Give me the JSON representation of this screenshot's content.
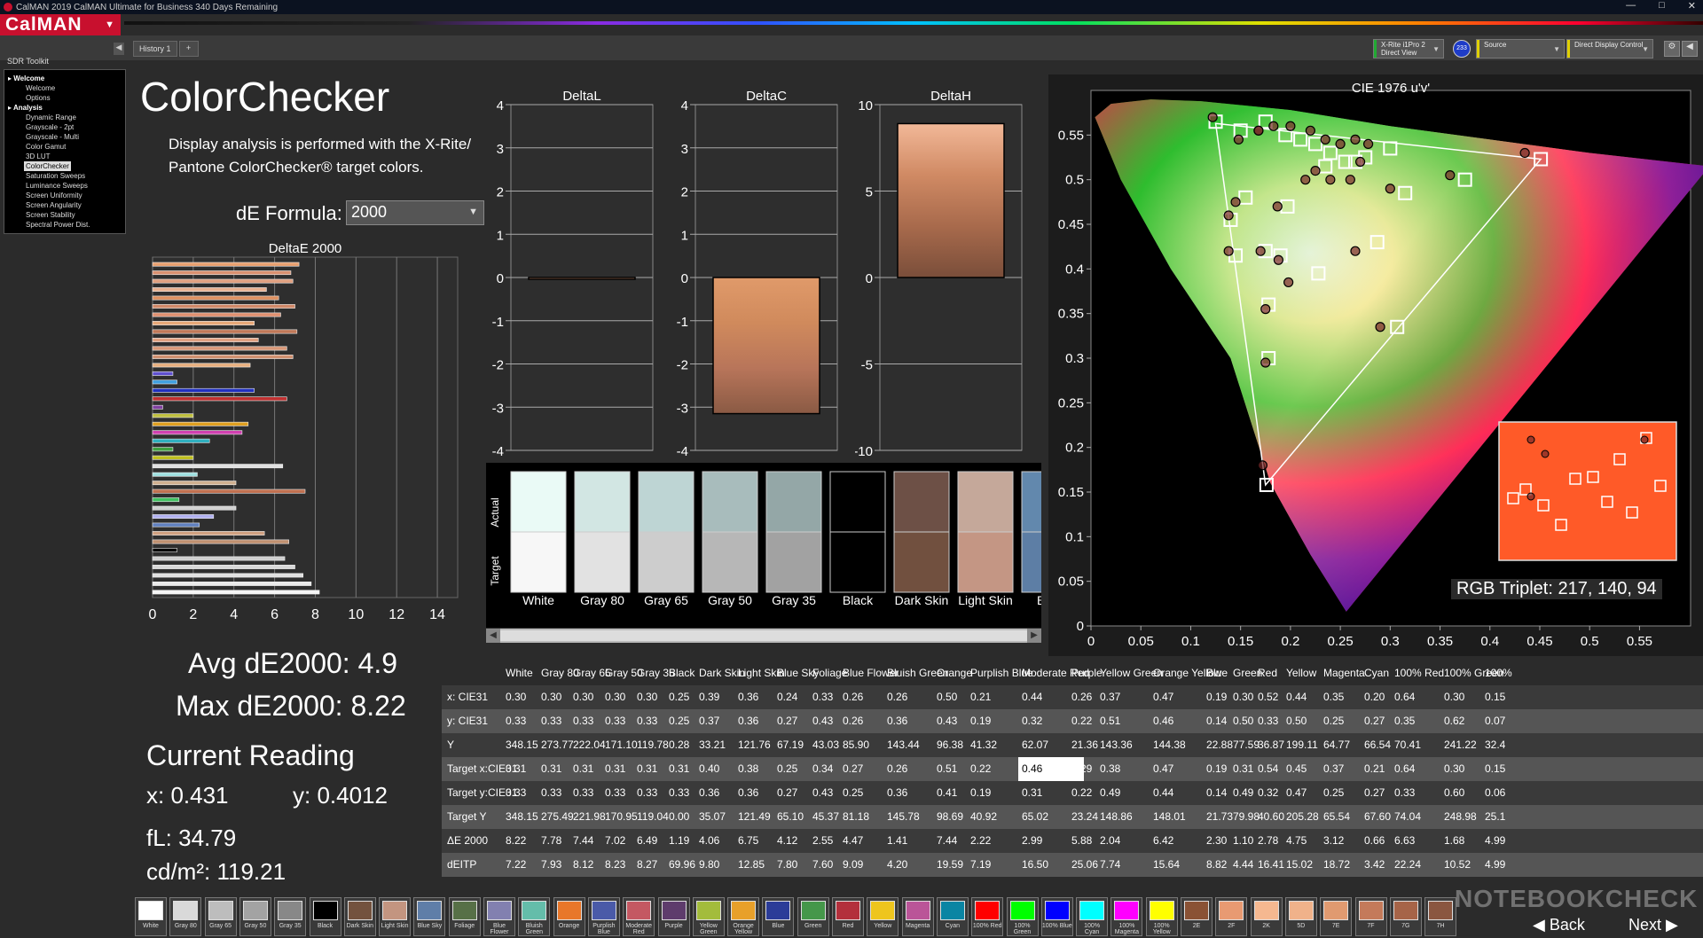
{
  "app": {
    "window_title": "CalMAN 2019 CalMAN Ultimate for Business 340 Days Remaining",
    "logo": "CalMAN",
    "window_buttons": [
      "—",
      "□",
      "✕"
    ]
  },
  "tabs": [
    {
      "label": "History 1"
    },
    {
      "label": "+"
    }
  ],
  "devices": {
    "meter": {
      "line1": "X-Rite i1Pro 2",
      "line2": "Direct View",
      "color": "#22aa33"
    },
    "badge": "233",
    "source": {
      "label": "Source",
      "color": "#e0d000"
    },
    "display": {
      "label": "Direct Display Control",
      "color": "#e0d000"
    }
  },
  "sidebar": {
    "title": "SDR Toolkit",
    "items": [
      {
        "label": "Welcome",
        "type": "group"
      },
      {
        "label": "Welcome",
        "type": "item"
      },
      {
        "label": "Options",
        "type": "item"
      },
      {
        "label": "Analysis",
        "type": "group"
      },
      {
        "label": "Dynamic Range",
        "type": "item"
      },
      {
        "label": "Grayscale - 2pt",
        "type": "item"
      },
      {
        "label": "Grayscale - Multi",
        "type": "item"
      },
      {
        "label": "Color Gamut",
        "type": "item"
      },
      {
        "label": "3D LUT",
        "type": "item"
      },
      {
        "label": "ColorChecker",
        "type": "item",
        "selected": true
      },
      {
        "label": "Saturation Sweeps",
        "type": "item"
      },
      {
        "label": "Luminance Sweeps",
        "type": "item"
      },
      {
        "label": "Screen Uniformity",
        "type": "item"
      },
      {
        "label": "Screen Angularity",
        "type": "item"
      },
      {
        "label": "Screen Stability",
        "type": "item"
      },
      {
        "label": "Spectral Power Dist.",
        "type": "item"
      }
    ]
  },
  "page": {
    "title": "ColorChecker",
    "description": "Display analysis is performed with the X-Rite/ Pantone ColorChecker® target colors.",
    "formula_label": "dE Formula:",
    "formula_value": "2000"
  },
  "stats": {
    "avg": "Avg dE2000: 4.9",
    "max": "Max dE2000: 8.22",
    "current_reading": "Current Reading",
    "x": "x: 0.431",
    "y": "y: 0.4012",
    "fl": "fL: 34.79",
    "cdm2": "cd/m²: 119.21"
  },
  "chart_data": [
    {
      "type": "bar",
      "title": "DeltaE 2000",
      "orientation": "horizontal",
      "xlim": [
        0,
        15
      ],
      "xticks": [
        "0",
        "2",
        "4",
        "6",
        "8",
        "10",
        "12",
        "14"
      ],
      "bars": [
        {
          "value": 7.2,
          "color": "#e8a070"
        },
        {
          "value": 6.8,
          "color": "#d99070"
        },
        {
          "value": 6.9,
          "color": "#e0a080"
        },
        {
          "value": 5.6,
          "color": "#e8b090"
        },
        {
          "value": 6.2,
          "color": "#dd9060"
        },
        {
          "value": 7.0,
          "color": "#d08868"
        },
        {
          "value": 6.3,
          "color": "#e09070"
        },
        {
          "value": 5.0,
          "color": "#e8a878"
        },
        {
          "value": 7.1,
          "color": "#c07858"
        },
        {
          "value": 5.2,
          "color": "#e0a080"
        },
        {
          "value": 6.6,
          "color": "#d89878"
        },
        {
          "value": 6.9,
          "color": "#d09070"
        },
        {
          "value": 4.8,
          "color": "#e8b080"
        },
        {
          "value": 1.0,
          "color": "#6050d0"
        },
        {
          "value": 1.2,
          "color": "#40a0e0"
        },
        {
          "value": 5.0,
          "color": "#2030c0"
        },
        {
          "value": 6.6,
          "color": "#c03030"
        },
        {
          "value": 0.5,
          "color": "#8040a0"
        },
        {
          "value": 2.0,
          "color": "#c0c040"
        },
        {
          "value": 4.7,
          "color": "#e0a020"
        },
        {
          "value": 4.4,
          "color": "#d040b0"
        },
        {
          "value": 2.8,
          "color": "#30b0c0"
        },
        {
          "value": 1.0,
          "color": "#40a040"
        },
        {
          "value": 2.0,
          "color": "#c0c020"
        },
        {
          "value": 6.4,
          "color": "#e0e0e0"
        },
        {
          "value": 2.2,
          "color": "#a0e0e0"
        },
        {
          "value": 4.1,
          "color": "#d0b090"
        },
        {
          "value": 7.5,
          "color": "#c07050"
        },
        {
          "value": 1.3,
          "color": "#40c060"
        },
        {
          "value": 4.1,
          "color": "#d0d0d0"
        },
        {
          "value": 3.0,
          "color": "#b0b0f0"
        },
        {
          "value": 2.3,
          "color": "#6080c0"
        },
        {
          "value": 5.5,
          "color": "#d0a080"
        },
        {
          "value": 6.7,
          "color": "#c09070"
        },
        {
          "value": 1.2,
          "color": "#000000"
        },
        {
          "value": 6.5,
          "color": "#cfcfcf"
        },
        {
          "value": 7.0,
          "color": "#d8d8d8"
        },
        {
          "value": 7.4,
          "color": "#e0e0e0"
        },
        {
          "value": 7.8,
          "color": "#eaeaea"
        },
        {
          "value": 8.2,
          "color": "#f5f5f5"
        }
      ]
    },
    {
      "type": "bar",
      "title": "DeltaL",
      "ylim": [
        -4,
        4
      ],
      "yticks": [
        "4",
        "3",
        "2",
        "1",
        "0",
        "-1",
        "-2",
        "-3",
        "-4"
      ],
      "value": 0.0
    },
    {
      "type": "bar",
      "title": "DeltaC",
      "ylim": [
        -4,
        4
      ],
      "yticks": [
        "4",
        "3",
        "2",
        "1",
        "0",
        "-1",
        "-2",
        "-3",
        "-4"
      ],
      "value": -3.15
    },
    {
      "type": "bar",
      "title": "DeltaH",
      "ylim": [
        -10,
        10
      ],
      "yticks": [
        "10",
        "5",
        "0",
        "-5",
        "-10"
      ],
      "value": 8.9
    },
    {
      "type": "scatter",
      "title": "CIE 1976 u'v'",
      "xlim": [
        0,
        0.6
      ],
      "ylim": [
        0,
        0.6
      ],
      "xticks": [
        "0",
        "0.05",
        "0.1",
        "0.15",
        "0.2",
        "0.25",
        "0.3",
        "0.35",
        "0.4",
        "0.45",
        "0.5",
        "0.55"
      ],
      "yticks": [
        "0",
        "0.05",
        "0.1",
        "0.15",
        "0.2",
        "0.25",
        "0.3",
        "0.35",
        "0.4",
        "0.45",
        "0.5",
        "0.55"
      ],
      "targets": [
        [
          0.125,
          0.565
        ],
        [
          0.15,
          0.555
        ],
        [
          0.175,
          0.565
        ],
        [
          0.195,
          0.55
        ],
        [
          0.21,
          0.545
        ],
        [
          0.225,
          0.54
        ],
        [
          0.24,
          0.53
        ],
        [
          0.255,
          0.52
        ],
        [
          0.265,
          0.52
        ],
        [
          0.235,
          0.515
        ],
        [
          0.275,
          0.525
        ],
        [
          0.3,
          0.535
        ],
        [
          0.315,
          0.485
        ],
        [
          0.375,
          0.5
        ],
        [
          0.451,
          0.523
        ],
        [
          0.155,
          0.48
        ],
        [
          0.14,
          0.455
        ],
        [
          0.145,
          0.415
        ],
        [
          0.175,
          0.42
        ],
        [
          0.19,
          0.415
        ],
        [
          0.197,
          0.47
        ],
        [
          0.228,
          0.395
        ],
        [
          0.287,
          0.43
        ],
        [
          0.178,
          0.36
        ],
        [
          0.178,
          0.3
        ],
        [
          0.307,
          0.335
        ],
        [
          0.176,
          0.158
        ]
      ],
      "measured": [
        [
          0.122,
          0.57
        ],
        [
          0.148,
          0.545
        ],
        [
          0.168,
          0.555
        ],
        [
          0.183,
          0.56
        ],
        [
          0.2,
          0.56
        ],
        [
          0.22,
          0.555
        ],
        [
          0.235,
          0.545
        ],
        [
          0.25,
          0.54
        ],
        [
          0.265,
          0.545
        ],
        [
          0.278,
          0.54
        ],
        [
          0.225,
          0.51
        ],
        [
          0.215,
          0.5
        ],
        [
          0.24,
          0.5
        ],
        [
          0.26,
          0.5
        ],
        [
          0.27,
          0.52
        ],
        [
          0.3,
          0.49
        ],
        [
          0.36,
          0.505
        ],
        [
          0.435,
          0.53
        ],
        [
          0.145,
          0.475
        ],
        [
          0.138,
          0.46
        ],
        [
          0.138,
          0.42
        ],
        [
          0.168,
          0.555
        ],
        [
          0.17,
          0.42
        ],
        [
          0.187,
          0.47
        ],
        [
          0.188,
          0.41
        ],
        [
          0.198,
          0.385
        ],
        [
          0.265,
          0.42
        ],
        [
          0.175,
          0.355
        ],
        [
          0.175,
          0.295
        ],
        [
          0.29,
          0.335
        ],
        [
          0.172,
          0.18
        ]
      ],
      "rgb_triplet": "RGB Triplet: 217, 140, 94"
    }
  ],
  "swatch_panel": {
    "actual_label": "Actual",
    "target_label": "Target",
    "swatches": [
      {
        "name": "White",
        "actual": "#eafaf6",
        "target": "#f7f7f7"
      },
      {
        "name": "Gray 80",
        "actual": "#d2e6e3",
        "target": "#e2e2e2"
      },
      {
        "name": "Gray 65",
        "actual": "#bed5d4",
        "target": "#cdcdcd"
      },
      {
        "name": "Gray 50",
        "actual": "#a8bcbc",
        "target": "#b7b7b7"
      },
      {
        "name": "Gray 35",
        "actual": "#94a7a7",
        "target": "#a2a2a2"
      },
      {
        "name": "Black",
        "actual": "#000000",
        "target": "#000000"
      },
      {
        "name": "Dark Skin",
        "actual": "#6d5046",
        "target": "#71503f"
      },
      {
        "name": "Light Skin",
        "actual": "#c5a89a",
        "target": "#c49684"
      },
      {
        "name": "Blue",
        "actual": "#6288ad",
        "target": "#5d7ea5"
      }
    ]
  },
  "table": {
    "columns": [
      "White",
      "Gray 80",
      "Gray 65",
      "Gray 50",
      "Gray 35",
      "Black",
      "Dark Skin",
      "Light Skin",
      "Blue Sky",
      "Foliage",
      "Blue Flower",
      "Bluish Green",
      "Orange",
      "Purplish Blue",
      "Moderate Red",
      "Purple",
      "Yellow Green",
      "Orange Yellow",
      "Blue",
      "Green",
      "Red",
      "Yellow",
      "Magenta",
      "Cyan",
      "100% Red",
      "100% Green",
      "100%"
    ],
    "rows": [
      {
        "label": "x: CIE31",
        "values": [
          "0.30",
          "0.30",
          "0.30",
          "0.30",
          "0.30",
          "0.25",
          "0.39",
          "0.36",
          "0.24",
          "0.33",
          "0.26",
          "0.26",
          "0.50",
          "0.21",
          "0.44",
          "0.26",
          "0.37",
          "0.47",
          "0.19",
          "0.30",
          "0.52",
          "0.44",
          "0.35",
          "0.20",
          "0.64",
          "0.30",
          "0.15"
        ]
      },
      {
        "label": "y: CIE31",
        "values": [
          "0.33",
          "0.33",
          "0.33",
          "0.33",
          "0.33",
          "0.25",
          "0.37",
          "0.36",
          "0.27",
          "0.43",
          "0.26",
          "0.36",
          "0.43",
          "0.19",
          "0.32",
          "0.22",
          "0.51",
          "0.46",
          "0.14",
          "0.50",
          "0.33",
          "0.50",
          "0.25",
          "0.27",
          "0.35",
          "0.62",
          "0.07"
        ]
      },
      {
        "label": "Y",
        "values": [
          "348.15",
          "273.77",
          "222.04",
          "171.10",
          "119.78",
          "0.28",
          "33.21",
          "121.76",
          "67.19",
          "43.03",
          "85.90",
          "143.44",
          "96.38",
          "41.32",
          "62.07",
          "21.36",
          "143.36",
          "144.38",
          "22.88",
          "77.59",
          "36.87",
          "199.11",
          "64.77",
          "66.54",
          "70.41",
          "241.22",
          "32.4"
        ]
      },
      {
        "label": "Target x:CIE31",
        "values": [
          "0.31",
          "0.31",
          "0.31",
          "0.31",
          "0.31",
          "0.31",
          "0.40",
          "0.38",
          "0.25",
          "0.34",
          "0.27",
          "0.26",
          "0.51",
          "0.22",
          "0.46",
          "0.29",
          "0.38",
          "0.47",
          "0.19",
          "0.31",
          "0.54",
          "0.45",
          "0.37",
          "0.21",
          "0.64",
          "0.30",
          "0.15"
        ]
      },
      {
        "label": "Target y:CIE31",
        "values": [
          "0.33",
          "0.33",
          "0.33",
          "0.33",
          "0.33",
          "0.33",
          "0.36",
          "0.36",
          "0.27",
          "0.43",
          "0.25",
          "0.36",
          "0.41",
          "0.19",
          "0.31",
          "0.22",
          "0.49",
          "0.44",
          "0.14",
          "0.49",
          "0.32",
          "0.47",
          "0.25",
          "0.27",
          "0.33",
          "0.60",
          "0.06"
        ]
      },
      {
        "label": "Target Y",
        "values": [
          "348.15",
          "275.49",
          "221.98",
          "170.95",
          "119.04",
          "0.00",
          "35.07",
          "121.49",
          "65.10",
          "45.37",
          "81.18",
          "145.78",
          "98.69",
          "40.92",
          "65.02",
          "23.24",
          "148.86",
          "148.01",
          "21.73",
          "79.98",
          "40.60",
          "205.28",
          "65.54",
          "67.60",
          "74.04",
          "248.98",
          "25.1"
        ]
      },
      {
        "label": "ΔE 2000",
        "values": [
          "8.22",
          "7.78",
          "7.44",
          "7.02",
          "6.49",
          "1.19",
          "4.06",
          "6.75",
          "4.12",
          "2.55",
          "4.47",
          "1.41",
          "7.44",
          "2.22",
          "2.99",
          "5.88",
          "2.04",
          "6.42",
          "2.30",
          "1.10",
          "2.78",
          "4.75",
          "3.12",
          "0.66",
          "6.63",
          "1.68",
          "4.99"
        ]
      },
      {
        "label": "dEITP",
        "values": [
          "7.22",
          "7.93",
          "8.12",
          "8.23",
          "8.27",
          "69.96",
          "9.80",
          "12.85",
          "7.80",
          "7.60",
          "9.09",
          "4.20",
          "19.59",
          "7.19",
          "16.50",
          "25.06",
          "7.74",
          "15.64",
          "8.82",
          "4.44",
          "16.41",
          "15.02",
          "18.72",
          "3.42",
          "22.24",
          "10.52",
          "4.99"
        ]
      }
    ]
  },
  "footer_swatches": [
    {
      "label": "White",
      "color": "#ffffff"
    },
    {
      "label": "Gray 80",
      "color": "#d9d9d9"
    },
    {
      "label": "Gray 65",
      "color": "#bdbdbd"
    },
    {
      "label": "Gray 50",
      "color": "#a3a3a3"
    },
    {
      "label": "Gray 35",
      "color": "#888888"
    },
    {
      "label": "Black",
      "color": "#000000"
    },
    {
      "label": "Dark Skin",
      "color": "#73523e"
    },
    {
      "label": "Light Skin",
      "color": "#c39580"
    },
    {
      "label": "Blue Sky",
      "color": "#5f7ea8"
    },
    {
      "label": "Foliage",
      "color": "#577047"
    },
    {
      "label": "Blue Flower",
      "color": "#8280b0"
    },
    {
      "label": "Bluish Green",
      "color": "#64bdaa"
    },
    {
      "label": "Orange",
      "color": "#e8772a"
    },
    {
      "label": "Purplish Blue",
      "color": "#4a5aa8"
    },
    {
      "label": "Moderate Red",
      "color": "#c45862"
    },
    {
      "label": "Purple",
      "color": "#5e3c6c"
    },
    {
      "label": "Yellow Green",
      "color": "#a3bc3c"
    },
    {
      "label": "Orange Yellow",
      "color": "#e8a02a"
    },
    {
      "label": "Blue",
      "color": "#2b3c98"
    },
    {
      "label": "Green",
      "color": "#45974a"
    },
    {
      "label": "Red",
      "color": "#b3303c"
    },
    {
      "label": "Yellow",
      "color": "#eec51d"
    },
    {
      "label": "Magenta",
      "color": "#ba5598"
    },
    {
      "label": "Cyan",
      "color": "#0a85a3"
    },
    {
      "label": "100% Red",
      "color": "#ff0000"
    },
    {
      "label": "100% Green",
      "color": "#00ff00"
    },
    {
      "label": "100% Blue",
      "color": "#0000ff"
    },
    {
      "label": "100% Cyan",
      "color": "#00ffff"
    },
    {
      "label": "100% Magenta",
      "color": "#ff00ff"
    },
    {
      "label": "100% Yellow",
      "color": "#ffff00"
    },
    {
      "label": "2E",
      "color": "#8a5235"
    },
    {
      "label": "2F",
      "color": "#e89a72"
    },
    {
      "label": "2K",
      "color": "#f5b890"
    },
    {
      "label": "5D",
      "color": "#f0b28a"
    },
    {
      "label": "7E",
      "color": "#e09a70"
    },
    {
      "label": "7F",
      "color": "#c47a5a"
    },
    {
      "label": "7G",
      "color": "#a66448"
    },
    {
      "label": "7H",
      "color": "#8a5640"
    }
  ],
  "nav": {
    "back": "Back",
    "next": "Next"
  },
  "watermark": "NOTEBOOKCHECK"
}
